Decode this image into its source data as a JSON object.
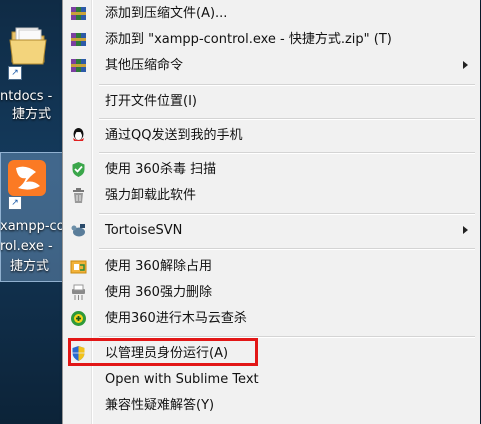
{
  "desktop": {
    "icon1_label_line1": "ntdocs -",
    "icon1_label_line2": "捷方式",
    "icon2_label_line1": "xampp-co",
    "icon2_label_line2": "rol.exe -",
    "icon2_label_line3": "捷方式"
  },
  "menu": {
    "items": [
      {
        "label": "添加到压缩文件(A)...",
        "icon": "winrar-icon"
      },
      {
        "label": "添加到 \"xampp-control.exe - 快捷方式.zip\" (T)",
        "icon": "winrar-icon"
      },
      {
        "label": "其他压缩命令",
        "icon": "winrar-icon"
      },
      {
        "label": "打开文件位置(I)",
        "icon": ""
      },
      {
        "label": "通过QQ发送到我的手机",
        "icon": "qq-icon"
      },
      {
        "label": "使用 360杀毒 扫描",
        "icon": "360-antivirus-icon"
      },
      {
        "label": "强力卸载此软件",
        "icon": "trash-icon"
      },
      {
        "label": "TortoiseSVN",
        "icon": "tortoisesvn-icon"
      },
      {
        "label": "使用 360解除占用",
        "icon": "360-unlock-icon"
      },
      {
        "label": "使用 360强力删除",
        "icon": "360-shredder-icon"
      },
      {
        "label": "使用360进行木马云查杀",
        "icon": "360-trojan-scan-icon"
      },
      {
        "label": "以管理员身份运行(A)",
        "icon": "uac-shield-icon"
      },
      {
        "label": "Open with Sublime Text",
        "icon": ""
      },
      {
        "label": "兼容性疑难解答(Y)",
        "icon": ""
      }
    ]
  },
  "colors": {
    "menu_bg": "#f1f1f1",
    "highlight_border": "#e21616"
  }
}
